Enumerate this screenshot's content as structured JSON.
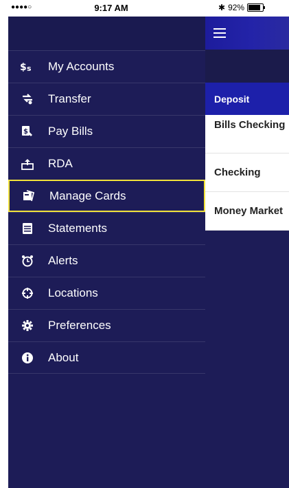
{
  "status_bar": {
    "signal": "●●●●○",
    "time": "9:17 AM",
    "bluetooth": "✱",
    "battery_percent": "92%"
  },
  "menu": {
    "items": [
      {
        "label": "My Accounts",
        "icon": "dollar-icon"
      },
      {
        "label": "Transfer",
        "icon": "transfer-icon"
      },
      {
        "label": "Pay Bills",
        "icon": "pay-bills-icon"
      },
      {
        "label": "RDA",
        "icon": "rda-upload-icon"
      },
      {
        "label": "Manage Cards",
        "icon": "card-icon",
        "selected": true
      },
      {
        "label": "Statements",
        "icon": "document-icon"
      },
      {
        "label": "Alerts",
        "icon": "alarm-clock-icon"
      },
      {
        "label": "Locations",
        "icon": "crosshair-icon"
      },
      {
        "label": "Preferences",
        "icon": "gear-icon"
      },
      {
        "label": "About",
        "icon": "info-icon"
      }
    ]
  },
  "content": {
    "section_header": "Deposit",
    "accounts": [
      "Bills Checking",
      "Checking",
      "Money Market"
    ]
  },
  "colors": {
    "menu_bg": "#1d1c57",
    "selected_border": "#f1e23a",
    "topbar_blue": "#2323a8",
    "deposit_bar": "#1d20aa"
  }
}
